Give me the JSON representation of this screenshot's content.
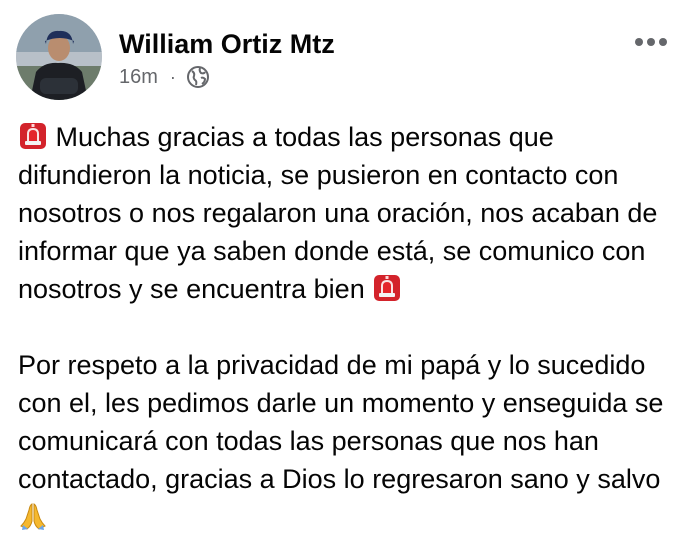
{
  "post": {
    "author": "William Ortiz Mtz",
    "time": "16m",
    "separator": "·",
    "audience_icon": "globe-icon",
    "more_icon": "more-options-icon",
    "paragraph1": {
      "lead_emoji": "police-light-icon",
      "text": "Muchas gracias a todas las personas que difundieron la noticia, se pusieron en contacto con nosotros o nos regalaron una oración, nos acaban de informar que ya saben donde está, se comunico con nosotros y se encuentra bien",
      "trail_emoji": "police-light-icon"
    },
    "paragraph2": {
      "text": "Por respeto a la privacidad de mi papá y lo sucedido con el, les pedimos darle un momento y enseguida se comunicará con todas las personas que nos han contactado, gracias a Dios lo regresaron sano y salvo",
      "trail_emoji": "praying-hands-icon"
    }
  },
  "colors": {
    "primary_text": "#050505",
    "secondary_text": "#65676b",
    "background": "#ffffff",
    "siren_red": "#e4252b"
  }
}
